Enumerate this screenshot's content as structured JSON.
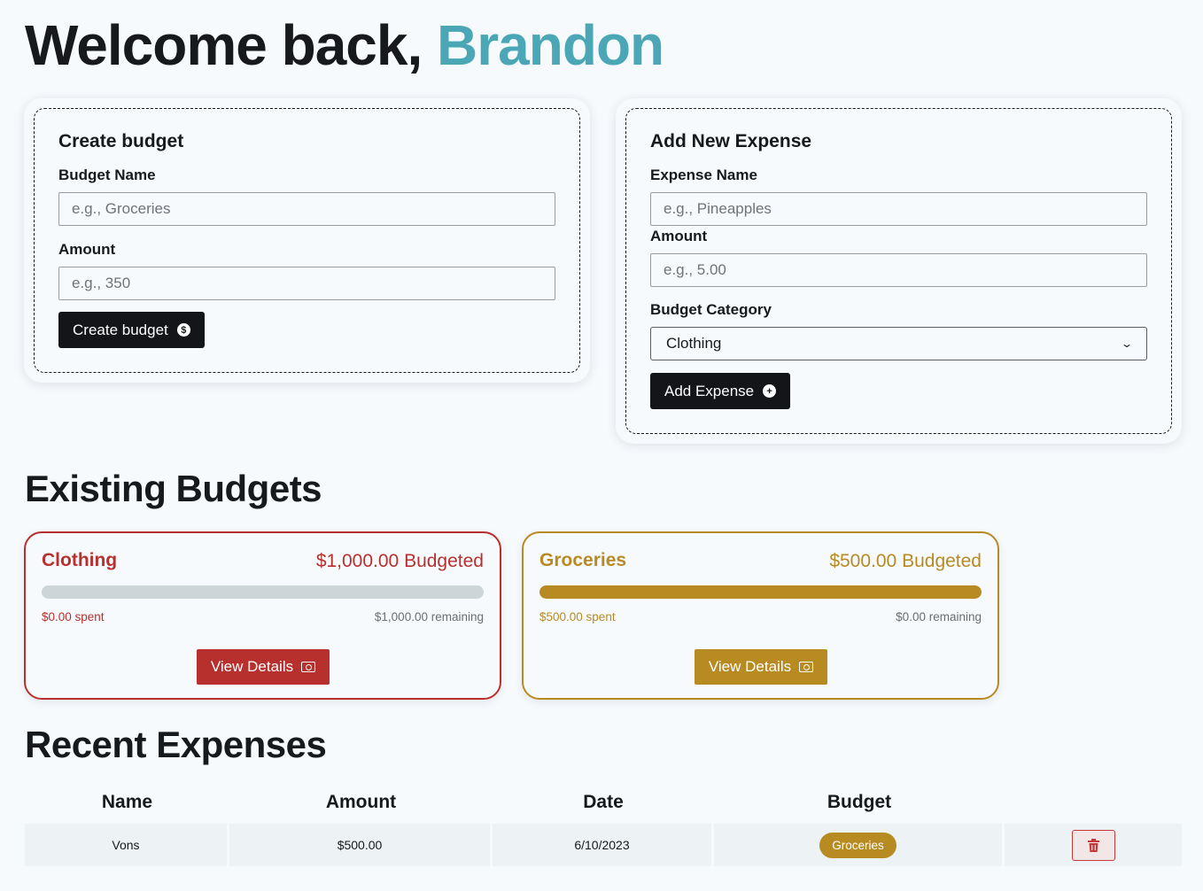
{
  "greeting": {
    "prefix": "Welcome back,",
    "username": "Brandon"
  },
  "create_budget": {
    "title": "Create budget",
    "name_label": "Budget Name",
    "name_placeholder": "e.g., Groceries",
    "amount_label": "Amount",
    "amount_placeholder": "e.g., 350",
    "button_label": "Create budget",
    "button_icon": "dollar-circle-icon"
  },
  "add_expense": {
    "title": "Add New Expense",
    "name_label": "Expense Name",
    "name_placeholder": "e.g., Pineapples",
    "amount_label": "Amount",
    "amount_placeholder": "e.g., 5.00",
    "category_label": "Budget Category",
    "category_selected": "Clothing",
    "button_label": "Add Expense",
    "button_icon": "plus-circle-icon"
  },
  "budgets_section": {
    "title": "Existing Budgets",
    "budgets": [
      {
        "name": "Clothing",
        "budgeted": "$1,000.00 Budgeted",
        "spent": "$0.00 spent",
        "remaining": "$1,000.00 remaining",
        "progress": 0,
        "color": "#b8302d",
        "button_label": "View Details"
      },
      {
        "name": "Groceries",
        "budgeted": "$500.00 Budgeted",
        "spent": "$500.00 spent",
        "remaining": "$0.00 remaining",
        "progress": 1,
        "color": "#b88a22",
        "button_label": "View Details"
      }
    ]
  },
  "expenses_section": {
    "title": "Recent Expenses",
    "columns": [
      "Name",
      "Amount",
      "Date",
      "Budget"
    ],
    "rows": [
      {
        "name": "Vons",
        "amount": "$500.00",
        "date": "6/10/2023",
        "budget": "Groceries",
        "budget_color": "#b88a22"
      }
    ]
  },
  "colors": {
    "accent": "#4ba6b5",
    "dark_button": "#131519",
    "background": "#f6fafd"
  }
}
